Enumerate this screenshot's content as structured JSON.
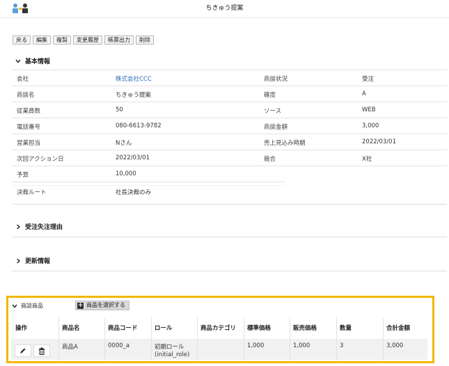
{
  "header": {
    "title": "ちきゅう提案"
  },
  "toolbar": {
    "buttons": [
      "戻る",
      "編集",
      "複製",
      "変更履歴",
      "帳票出力",
      "削除"
    ]
  },
  "basic_info": {
    "title": "基本情報",
    "left": [
      {
        "label": "会社",
        "value": "株式会社CCC"
      },
      {
        "label": "商談名",
        "value": "ちきゅう提案"
      },
      {
        "label": "従業員数",
        "value": "50"
      },
      {
        "label": "電話番号",
        "value": "080-6613-9782"
      },
      {
        "label": "営業担当",
        "value": "Nさん"
      },
      {
        "label": "次回アクション日",
        "value": "2022/03/01"
      },
      {
        "label": "予算",
        "value": "10,000"
      },
      {
        "label": "決裁ルート",
        "value": "社長決裁のみ"
      }
    ],
    "right": [
      {
        "label": "商談状況",
        "value": "受注"
      },
      {
        "label": "確度",
        "value": "A"
      },
      {
        "label": "ソース",
        "value": "WEB"
      },
      {
        "label": "商談金額",
        "value": "3,000"
      },
      {
        "label": "売上見込み時期",
        "value": "2022/03/01"
      },
      {
        "label": "競合",
        "value": "X社"
      }
    ]
  },
  "sections": {
    "order_reason": "受注失注理由",
    "update_info": "更新情報"
  },
  "products": {
    "title": "商談商品",
    "select_button": "商品を選択する",
    "columns": [
      "操作",
      "商品名",
      "商品コード",
      "ロール",
      "商品カテゴリ",
      "標準価格",
      "販売価格",
      "数量",
      "合計金額"
    ],
    "rows": [
      {
        "name": "商品A",
        "code": "0000_a",
        "role": "初期ロール",
        "role_sub": "(initial_role)",
        "category": "",
        "standard_price": "1,000",
        "sale_price": "1,000",
        "quantity": "3",
        "total": "3,000"
      }
    ]
  },
  "colors": {
    "highlight": "#f2b600",
    "link": "#2a6ebb"
  }
}
